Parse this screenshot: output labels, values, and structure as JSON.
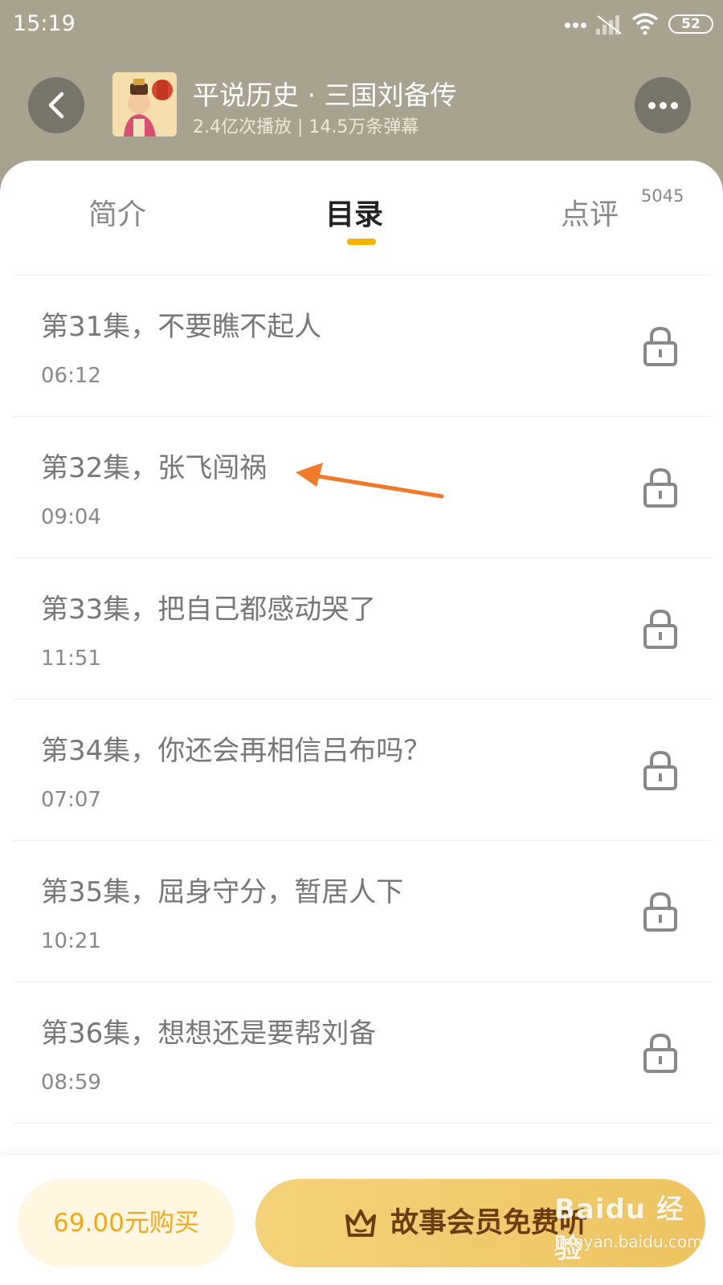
{
  "status_bar": {
    "time": "15:19",
    "battery": "52"
  },
  "header": {
    "title": "平说历史 · 三国刘备传",
    "stats": "2.4亿次播放 | 14.5万条弹幕",
    "back_icon": "chevron-left-icon",
    "more_icon": "more-dots-icon"
  },
  "tabs": [
    {
      "label": "简介"
    },
    {
      "label": "目录",
      "active": true
    },
    {
      "label": "点评",
      "count": "5045"
    }
  ],
  "episodes": [
    {
      "title": "第31集，不要瞧不起人",
      "duration": "06:12",
      "locked": true
    },
    {
      "title": "第32集，张飞闯祸",
      "duration": "09:04",
      "locked": true
    },
    {
      "title": "第33集，把自己都感动哭了",
      "duration": "11:51",
      "locked": true
    },
    {
      "title": "第34集，你还会再相信吕布吗？",
      "duration": "07:07",
      "locked": true
    },
    {
      "title": "第35集，屈身守分，暂居人下",
      "duration": "10:21",
      "locked": true
    },
    {
      "title": "第36集，想想还是要帮刘备",
      "duration": "08:59",
      "locked": true
    }
  ],
  "bottom_bar": {
    "buy_label": "69.00元购买",
    "member_label": "故事会员免费听"
  },
  "watermark": {
    "logo": "Baidu 经验",
    "url": "jingyan.baidu.com"
  },
  "colors": {
    "accent": "#f5b400",
    "header_bg": "#a8a290",
    "arrow": "#f07a2a",
    "member_gold": "#f0c868"
  }
}
